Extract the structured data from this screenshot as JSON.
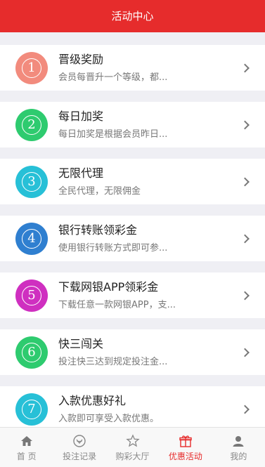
{
  "header": {
    "title": "活动中心"
  },
  "activities": [
    {
      "number": "1",
      "title": "晋级奖励",
      "desc": "会员每晋升一个等级，都...",
      "color": "#f28b7d"
    },
    {
      "number": "2",
      "title": "每日加奖",
      "desc": "每日加奖是根据会员昨日...",
      "color": "#2ecb6f"
    },
    {
      "number": "3",
      "title": "无限代理",
      "desc": "全民代理，无限佣金",
      "color": "#27c0d7"
    },
    {
      "number": "4",
      "title": "银行转账领彩金",
      "desc": "使用银行转账方式即可参...",
      "color": "#2f7fd0"
    },
    {
      "number": "5",
      "title": "下载网银APP领彩金",
      "desc": "下载任意一款网银APP，支...",
      "color": "#cf2fc0"
    },
    {
      "number": "6",
      "title": "快三闯关",
      "desc": "投注快三达到规定投注金...",
      "color": "#2ecb6f"
    },
    {
      "number": "7",
      "title": "入款优惠好礼",
      "desc": "入款即可享受入款优惠。",
      "color": "#27c0d7"
    }
  ],
  "tabbar": {
    "tabs": [
      {
        "label": "首 页",
        "icon": "home-icon",
        "active": false
      },
      {
        "label": "投注记录",
        "icon": "bet-record-icon",
        "active": false
      },
      {
        "label": "购彩大厅",
        "icon": "lottery-hall-icon",
        "active": false
      },
      {
        "label": "优惠活动",
        "icon": "gift-icon",
        "active": true
      },
      {
        "label": "我的",
        "icon": "user-icon",
        "active": false
      }
    ],
    "active_color": "#e62c2c"
  }
}
